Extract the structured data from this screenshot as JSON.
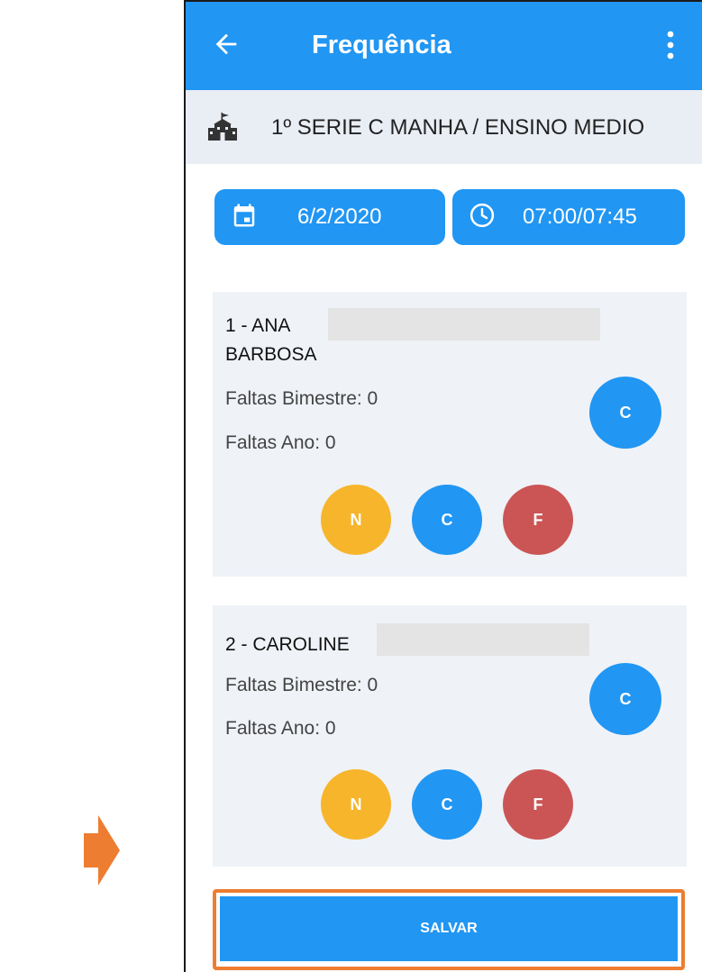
{
  "appbar": {
    "title": "Frequência"
  },
  "class_info": {
    "name": "1º SERIE C MANHA / ENSINO MEDIO"
  },
  "date": "6/2/2020",
  "time": "07:00/07:45",
  "students": [
    {
      "name_line1": "1 - ANA",
      "name_line2": "BARBOSA",
      "faltas_bimestre": "Faltas Bimestre: 0",
      "faltas_ano": "Faltas Ano: 0",
      "status": "C"
    },
    {
      "name_line1": "2 - CAROLINE",
      "faltas_bimestre": "Faltas Bimestre: 0",
      "faltas_ano": "Faltas Ano: 0",
      "status": "C"
    }
  ],
  "options": {
    "n": "N",
    "c": "C",
    "f": "F"
  },
  "save_label": "SALVAR",
  "colors": {
    "primary": "#2196f3",
    "n_option": "#f7b52b",
    "f_option": "#cb5555",
    "highlight": "#ed7d31"
  },
  "icons": {
    "back": "arrow-left-icon",
    "more": "more-vert-icon",
    "school": "school-icon",
    "calendar": "calendar-icon",
    "clock": "clock-icon",
    "annotation": "arrow-right-icon"
  }
}
